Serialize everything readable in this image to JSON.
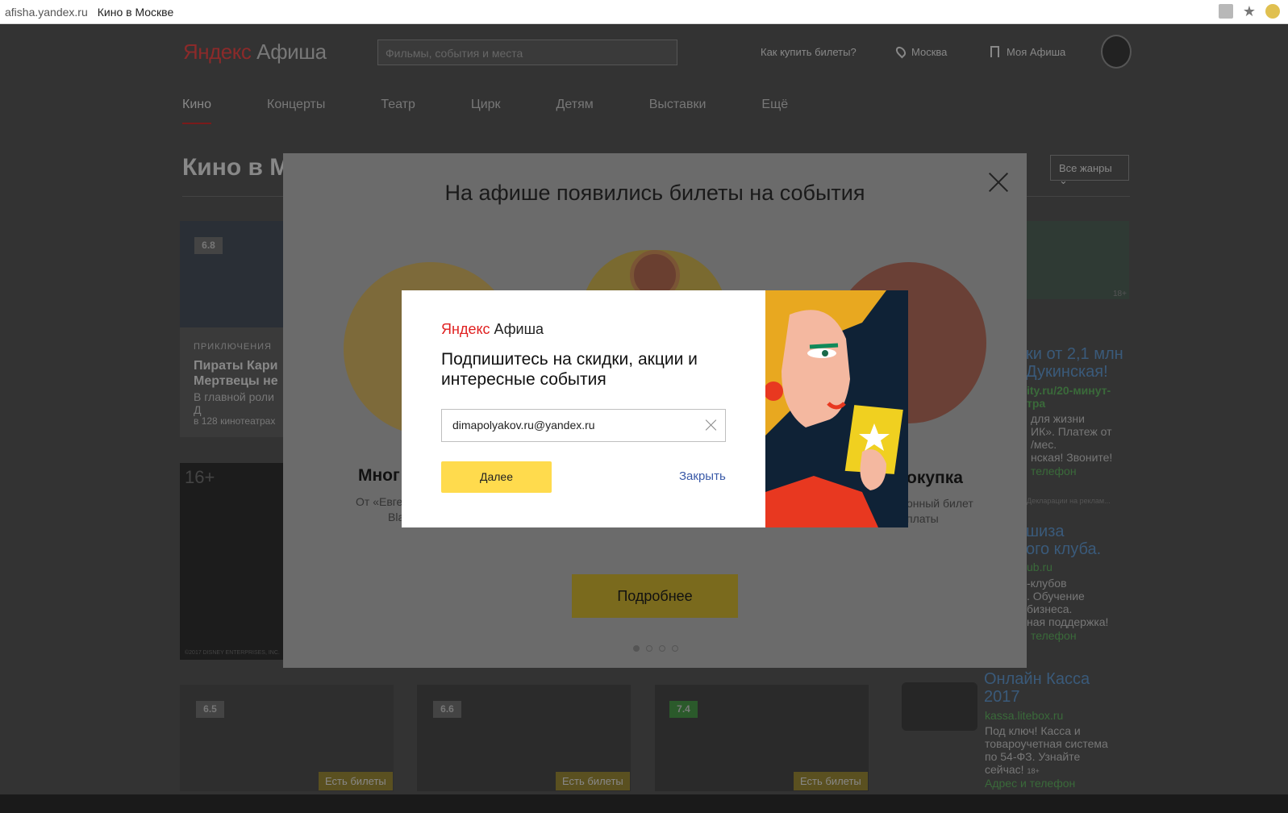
{
  "browser": {
    "url": "afisha.yandex.ru",
    "page_title": "Кино в Москве"
  },
  "header": {
    "logo_ya": "Яндекс",
    "logo_rest": " Афиша",
    "search_placeholder": "Фильмы, события и места",
    "how_to_buy": "Как купить билеты?",
    "city": "Москва",
    "my_afisha": "Моя Афиша"
  },
  "nav": {
    "items": [
      "Кино",
      "Концерты",
      "Театр",
      "Цирк",
      "Детям",
      "Выставки",
      "Ещё"
    ]
  },
  "main": {
    "title": "Кино в М",
    "genre_filter": "Все жанры",
    "movie1": {
      "rating": "6.8",
      "genre": "ПРИКЛЮЧЕНИЯ",
      "title_line1": "Пираты Кари",
      "title_line2": "Мертвецы не",
      "desc": "В главной роли Д",
      "cinemas": "в 128 кинотеатрах"
    },
    "movie2": {
      "age": "16+",
      "copyright": "©2017 DISNEY ENTERPRISES, INC."
    },
    "bottom_cards": [
      {
        "rating": "6.5",
        "tickets": "Есть билеты"
      },
      {
        "rating": "6.6",
        "tickets": "Есть билеты"
      },
      {
        "rating": "7.4",
        "tickets": "Есть билеты"
      }
    ]
  },
  "ads": {
    "ad1": {
      "age": "18+",
      "title_line1": "ки от 2,1 млн",
      "title_line2": "Дукинская!",
      "domain": "ity.ru/20-минут-",
      "domain2": "тра",
      "text1": "для жизни",
      "text2": "ИК». Платеж от",
      "text3": "/мес.",
      "text4": "нская! Звоните!",
      "contact": "телефон",
      "small": "Декларации на реклам..."
    },
    "ad2": {
      "title_line1": "шиза",
      "title_line2": "ого клуба.",
      "domain": "ub.ru",
      "text1": "-клубов",
      "text2": ". Обучение",
      "text3": "бизнеса.",
      "text4": "ная поддержка!",
      "contact": "телефон"
    },
    "ad3": {
      "title_line1": "Онлайн Касса",
      "title_line2": "2017",
      "domain": "kassa.litebox.ru",
      "text1": "Под ключ! Касса и",
      "text2": "товароучетная система",
      "text3": "по 54-ФЗ. Узнайте",
      "text4": "сейчас!",
      "age": "18+",
      "contact": "Адрес и телефон"
    }
  },
  "overlay": {
    "title": "На афише появились билеты на события",
    "left_heading": "Мног",
    "left_text1": "От «Евге",
    "left_text2": "Bla",
    "right_heading": "окупка",
    "right_text1": "онный билет",
    "right_text2": "платы",
    "button": "Подробнее",
    "dots": [
      true,
      false,
      false,
      false
    ]
  },
  "modal": {
    "logo_ya": "Яндекс",
    "logo_rest": " Афиша",
    "title": "Подпишитесь на скидки, акции и интересные события",
    "email": "dimapolyakov.ru@yandex.ru",
    "next_button": "Далее",
    "close_link": "Закрыть"
  },
  "colors": {
    "accent_yellow": "#ffdb4d",
    "link_blue": "#3a5aa8",
    "logo_red": "#e02020"
  }
}
